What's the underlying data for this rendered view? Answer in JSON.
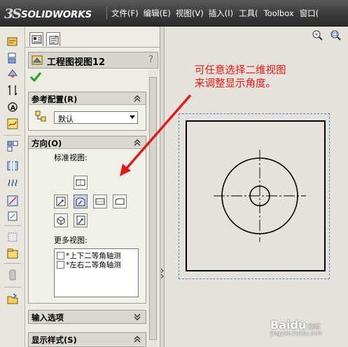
{
  "app": {
    "brand_mark": "3S",
    "brand_name": "SOLIDWORKS",
    "colors": {
      "menubar": "#3a3a3a",
      "annotation": "#e11919",
      "sheet_frame_dashed": "#4f86c6"
    }
  },
  "menu": {
    "items": [
      "文件(F)",
      "编辑(E)",
      "视图(V)",
      "插入(I)",
      "工具(",
      "Toolbox",
      "窗口("
    ]
  },
  "property_manager": {
    "title": "工程图视图12",
    "help": "?",
    "tabs": [
      "property-manager-tab",
      "configuration-tab"
    ],
    "sections": {
      "reference_config": {
        "label": "参考配置(R)",
        "value": "默认"
      },
      "orientation": {
        "label": "方向(O)",
        "standard_views_label": "标准视图:",
        "more_views_label": "更多视图:",
        "more_views": [
          "*上下二等角轴测",
          "*左右二等角轴测"
        ]
      },
      "import_options": {
        "label": "输入选项"
      },
      "display_style": {
        "label": "显示样式(S)"
      }
    }
  },
  "canvas": {
    "annotation_line1": "可任意选择二维视图",
    "annotation_line2": "来调整显示角度。",
    "icons": [
      "zoom-to-fit-icon",
      "zoom-area-icon"
    ]
  },
  "watermark": {
    "text": "Bai",
    "paw": "du",
    "suffix": "经验",
    "url": "jingyan.baidu.com"
  }
}
